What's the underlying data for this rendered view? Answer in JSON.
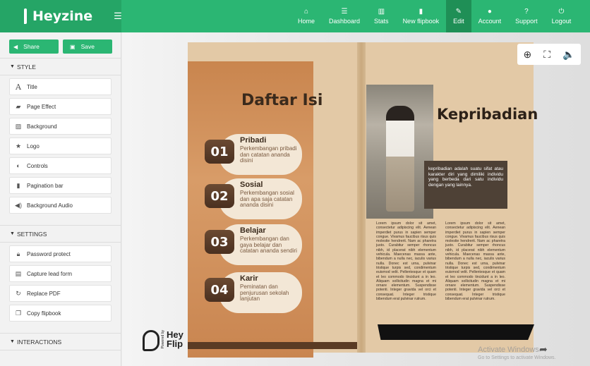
{
  "brand": {
    "name": "Heyzine"
  },
  "nav": [
    {
      "icon": "home-icon",
      "glyph": "⌂",
      "label": "Home"
    },
    {
      "icon": "dashboard-icon",
      "glyph": "☰",
      "label": "Dashboard"
    },
    {
      "icon": "stats-icon",
      "glyph": "▥",
      "label": "Stats"
    },
    {
      "icon": "new-flipbook-icon",
      "glyph": "▮",
      "label": "New flipbook"
    },
    {
      "icon": "edit-icon",
      "glyph": "✎",
      "label": "Edit"
    },
    {
      "icon": "account-icon",
      "glyph": "●",
      "label": "Account"
    },
    {
      "icon": "support-icon",
      "glyph": "?",
      "label": "Support"
    },
    {
      "icon": "logout-icon",
      "glyph": "⏻",
      "label": "Logout"
    }
  ],
  "sidebar": {
    "share_label": "Share",
    "save_label": "Save",
    "style_header": "STYLE",
    "style_items": [
      "Title",
      "Page Effect",
      "Background",
      "Logo",
      "Controls",
      "Pagination bar",
      "Background Audio"
    ],
    "settings_header": "SETTINGS",
    "settings_items": [
      "Password protect",
      "Capture lead form",
      "Replace PDF",
      "Copy flipbook"
    ],
    "interactions_header": "INTERACTIONS"
  },
  "book": {
    "left": {
      "title": "Daftar Isi",
      "items": [
        {
          "num": "01",
          "head": "Pribadi",
          "desc": "Perkembangan pribadi dan catatan ananda disini"
        },
        {
          "num": "02",
          "head": "Sosial",
          "desc": "Perkembangan sosial dan apa saja catatan ananda disini"
        },
        {
          "num": "03",
          "head": "Belajar",
          "desc": "Perkembangan dan gaya belajar dan catatan ananda sendiri"
        },
        {
          "num": "04",
          "head": "Karir",
          "desc": "Peminatan dan penjurusan sekolah lanjutan"
        }
      ]
    },
    "right": {
      "title": "Kepribadian",
      "box_text": "kepribadian adalah suatu sifat atau karakter diri yang dimiliki individu yang berbeda dari satu individu dengan yang lainnya.",
      "lorem": "Lorem ipsum dolor sit amet, consectetur adipiscing elit. Aenean imperdiet purus in sapien semper congue. Vivamus faucibus risus quis molestie hendrerit. Nam ac pharetra justo. Curabitur semper rhoncus nibh, id placerat nibh elementum vehicula. Maecenas massa ante, bibendum a nulla nec, iaculis varius nulla. Donec est urna, pulvinar tristique turpis sed, condimentum euismod velit. Pellentesque et quam et leo commodo tincidunt a in leo. Aliquam sollicitudin magna et mi ornare elementum. Suspendisse potenti. Integer gravida vel orci et consequat. Integer tristique bibendum erat pulvinar rutrum."
    }
  },
  "tools": {
    "zoom": "⊕",
    "fullscreen": "⛶",
    "sound": "🔈"
  },
  "footer_logo": {
    "text1": "Hey",
    "text2": "Flip",
    "vertical": "Powered by"
  },
  "watermark": {
    "title": "Activate Windows",
    "sub": "Go to Settings to activate Windows."
  }
}
